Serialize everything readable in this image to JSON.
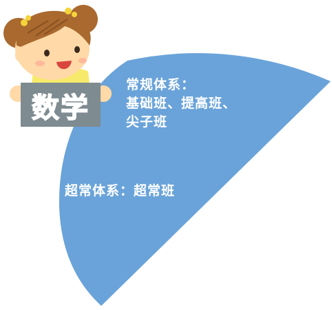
{
  "sign": {
    "label": "数学"
  },
  "regular_system": {
    "line1": "常规体系：",
    "line2": "基础班、提高班、",
    "line3": "尖子班"
  },
  "super_system": {
    "line1": "超常体系：超常班"
  },
  "colors": {
    "wedge": "#6aa3d9",
    "sign_board": "#7e8b90",
    "hair": "#a9692f",
    "skin": "#ffd9a8",
    "shirt": "#f7ea6a",
    "bow": "#f5d43a"
  },
  "icons": {
    "character": "cartoon-girl-holding-sign-icon"
  }
}
